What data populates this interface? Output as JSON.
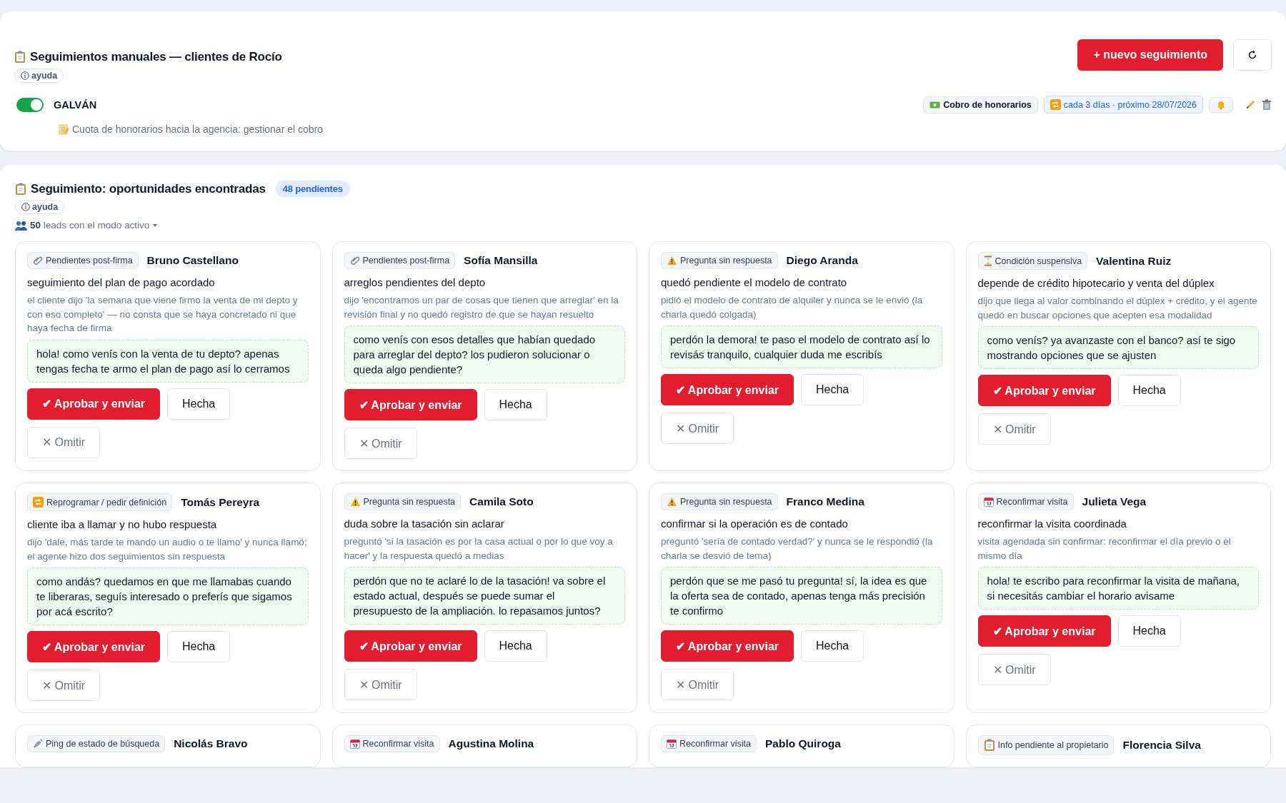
{
  "manual": {
    "title": "Seguimientos manuales — clientes de Rocío",
    "help": "ayuda",
    "new_button": "+ nuevo seguimiento",
    "items": [
      {
        "name": "GALVÁN",
        "on": true,
        "category": "Cobro de honorarios",
        "schedule": "cada 3 días · próximo 28/07/2026",
        "note": "Cuota de honorarios hacia la agencia: gestionar el cobro"
      }
    ]
  },
  "opportunities": {
    "title": "Seguimiento: oportunidades encontradas",
    "badge": "48 pendientes",
    "help": "ayuda",
    "leads": "**50** leads con el modo activo",
    "cards": [
      {
        "tag": {
          "kind": "post-firma",
          "label": "Pendientes post-firma"
        },
        "name": "Bruno Castellano",
        "summary": "seguimiento del plan de pago acordado",
        "detail": "el cliente dijo 'la semana que viene firmo la venta de mi depto y con eso completo' — no consta que se haya concretado ni que haya fecha de firma",
        "message": "hola! como venís con la venta de tu depto? apenas tengas fecha te armo el plan de pago así lo cerramos",
        "actions": [
          "✔ Aprobar y enviar",
          "Hecha",
          "✕ Omitir"
        ]
      },
      {
        "tag": {
          "kind": "post-firma",
          "label": "Pendientes post-firma"
        },
        "name": "Sofía Mansilla",
        "summary": "arreglos pendientes del depto",
        "detail": "dijo 'encontramos un par de cosas que tienen que arreglar' en la revisión final y no quedó registro de que se hayan resuelto",
        "message": "como venís con esos detalles que habían quedado para arreglar del depto? los pudieron solucionar o queda algo pendiente?",
        "actions": [
          "✔ Aprobar y enviar",
          "Hecha",
          "✕ Omitir"
        ]
      },
      {
        "tag": {
          "kind": "pregunta",
          "label": "Pregunta sin respuesta"
        },
        "name": "Diego Aranda",
        "summary": "quedó pendiente el modelo de contrato",
        "detail": "pidió el modelo de contrato de alquiler y nunca se le envió (la charla quedó colgada)",
        "message": "perdón la demora! te paso el modelo de contrato así lo revisás tranquilo, cualquier duda me escribís",
        "actions": [
          "✔ Aprobar y enviar",
          "Hecha",
          "✕ Omitir"
        ]
      },
      {
        "tag": {
          "kind": "suspensiva",
          "label": "Condición suspensiva"
        },
        "name": "Valentina Ruiz",
        "summary": "depende de crédito hipotecario y venta del dúplex",
        "detail": "dijo que llega al valor combinando el dúplex + crédito, y el agente quedó en buscar opciones que acepten esa modalidad",
        "message": "como venís? ya avanzaste con el banco? así te sigo mostrando opciones que se ajusten",
        "actions": [
          "✔ Aprobar y enviar",
          "Hecha",
          "✕ Omitir"
        ]
      },
      {
        "tag": {
          "kind": "reprogramar",
          "label": "Reprogramar / pedir definición"
        },
        "name": "Tomás Pereyra",
        "summary": "cliente iba a llamar y no hubo respuesta",
        "detail": "dijo 'dale, más tarde te mando un audio o te llamo' y nunca llamó; el agente hizo dos seguimientos sin respuesta",
        "message": "como andás? quedamos en que me llamabas cuando te liberaras, seguís interesado o preferís que sigamos por acá escrito?",
        "actions": [
          "✔ Aprobar y enviar",
          "Hecha",
          "✕ Omitir"
        ]
      },
      {
        "tag": {
          "kind": "pregunta",
          "label": "Pregunta sin respuesta"
        },
        "name": "Camila Soto",
        "summary": "duda sobre la tasación sin aclarar",
        "detail": "preguntó 'si la tasación es por la casa actual o por lo que voy a hacer' y la respuesta quedó a medias",
        "message": "perdón que no te aclaré lo de la tasación! va sobre el estado actual, después se puede sumar el presupuesto de la ampliación. lo repasamos juntos?",
        "actions": [
          "✔ Aprobar y enviar",
          "Hecha",
          "✕ Omitir"
        ]
      },
      {
        "tag": {
          "kind": "pregunta",
          "label": "Pregunta sin respuesta"
        },
        "name": "Franco Medina",
        "summary": "confirmar si la operación es de contado",
        "detail": "preguntó 'sería de contado verdad?' y nunca se le respondió (la charla se desvió de tema)",
        "message": "perdón que se me pasó tu pregunta! sí, la idea es que la oferta sea de contado, apenas tenga más precisión te confirmo",
        "actions": [
          "✔ Aprobar y enviar",
          "Hecha",
          "✕ Omitir"
        ]
      },
      {
        "tag": {
          "kind": "visita",
          "label": "Reconfirmar visita"
        },
        "name": "Julieta Vega",
        "summary": "reconfirmar la visita coordinada",
        "detail": "visita agendada sin confirmar: reconfirmar el día previo o el mismo día",
        "message": "hola! te escribo para reconfirmar la visita de mañana, si necesitás cambiar el horario avisame",
        "actions": [
          "✔ Aprobar y enviar",
          "Hecha",
          "✕ Omitir"
        ]
      },
      {
        "tag": {
          "kind": "ping",
          "label": "Ping de estado de búsqueda"
        },
        "name": "Nicolás Bravo"
      },
      {
        "tag": {
          "kind": "visita",
          "label": "Reconfirmar visita"
        },
        "name": "Agustina Molina"
      },
      {
        "tag": {
          "kind": "visita",
          "label": "Reconfirmar visita"
        },
        "name": "Pablo Quiroga"
      },
      {
        "tag": {
          "kind": "info",
          "label": "Info pendiente al propietario"
        },
        "name": "Florencia Silva"
      }
    ]
  }
}
